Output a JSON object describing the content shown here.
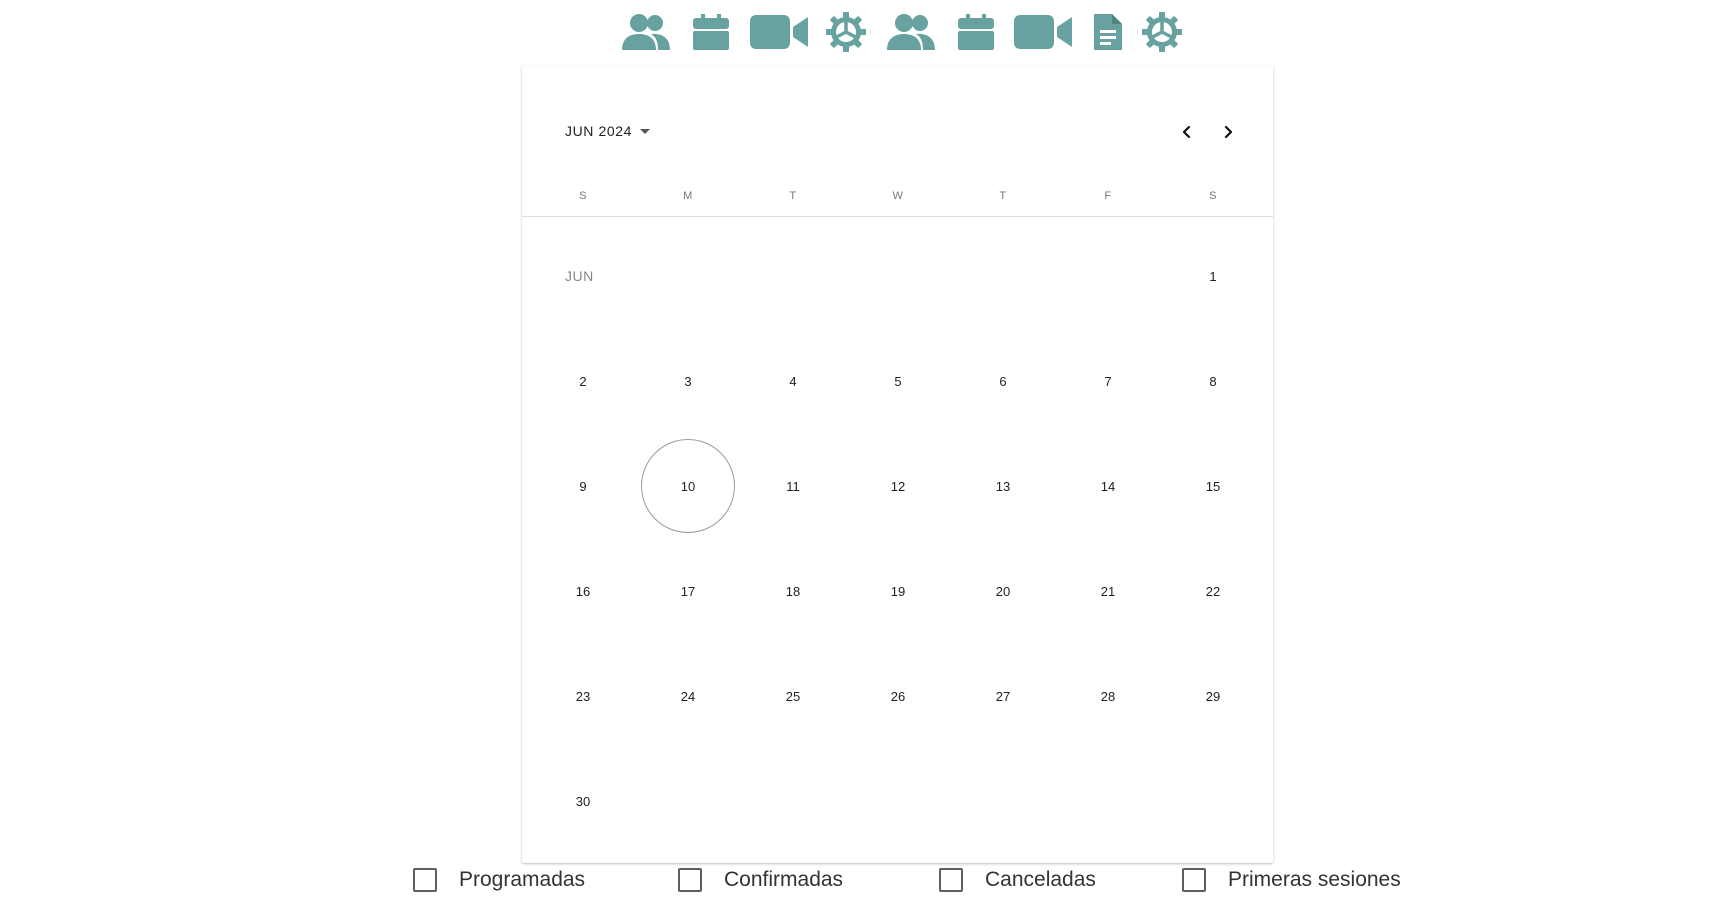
{
  "theme": {
    "icon_color": "#68a2a0",
    "text_color": "#222222",
    "muted_text": "#888888"
  },
  "toolbar": {
    "icons": [
      {
        "name": "users-icon"
      },
      {
        "name": "calendar-icon"
      },
      {
        "name": "video-icon"
      },
      {
        "name": "settings-icon"
      },
      {
        "name": "users-icon"
      },
      {
        "name": "calendar-icon"
      },
      {
        "name": "video-icon"
      },
      {
        "name": "document-icon"
      },
      {
        "name": "settings-icon"
      }
    ]
  },
  "calendar": {
    "header_label": "JUN 2024",
    "prev_icon": "chevron-left-icon",
    "next_icon": "chevron-right-icon",
    "weekdays": [
      "S",
      "M",
      "T",
      "W",
      "T",
      "F",
      "S"
    ],
    "month_label": "JUN",
    "weeks": [
      [
        "",
        "",
        "",
        "",
        "",
        "",
        "1"
      ],
      [
        "2",
        "3",
        "4",
        "5",
        "6",
        "7",
        "8"
      ],
      [
        "9",
        "10",
        "11",
        "12",
        "13",
        "14",
        "15"
      ],
      [
        "16",
        "17",
        "18",
        "19",
        "20",
        "21",
        "22"
      ],
      [
        "23",
        "24",
        "25",
        "26",
        "27",
        "28",
        "29"
      ],
      [
        "30",
        "",
        "",
        "",
        "",
        "",
        ""
      ]
    ],
    "today": "10"
  },
  "filters": {
    "items": [
      {
        "label": "Programadas",
        "checked": false
      },
      {
        "label": "Confirmadas",
        "checked": false
      },
      {
        "label": "Canceladas",
        "checked": false
      },
      {
        "label": "Primeras sesiones",
        "checked": false
      }
    ]
  }
}
